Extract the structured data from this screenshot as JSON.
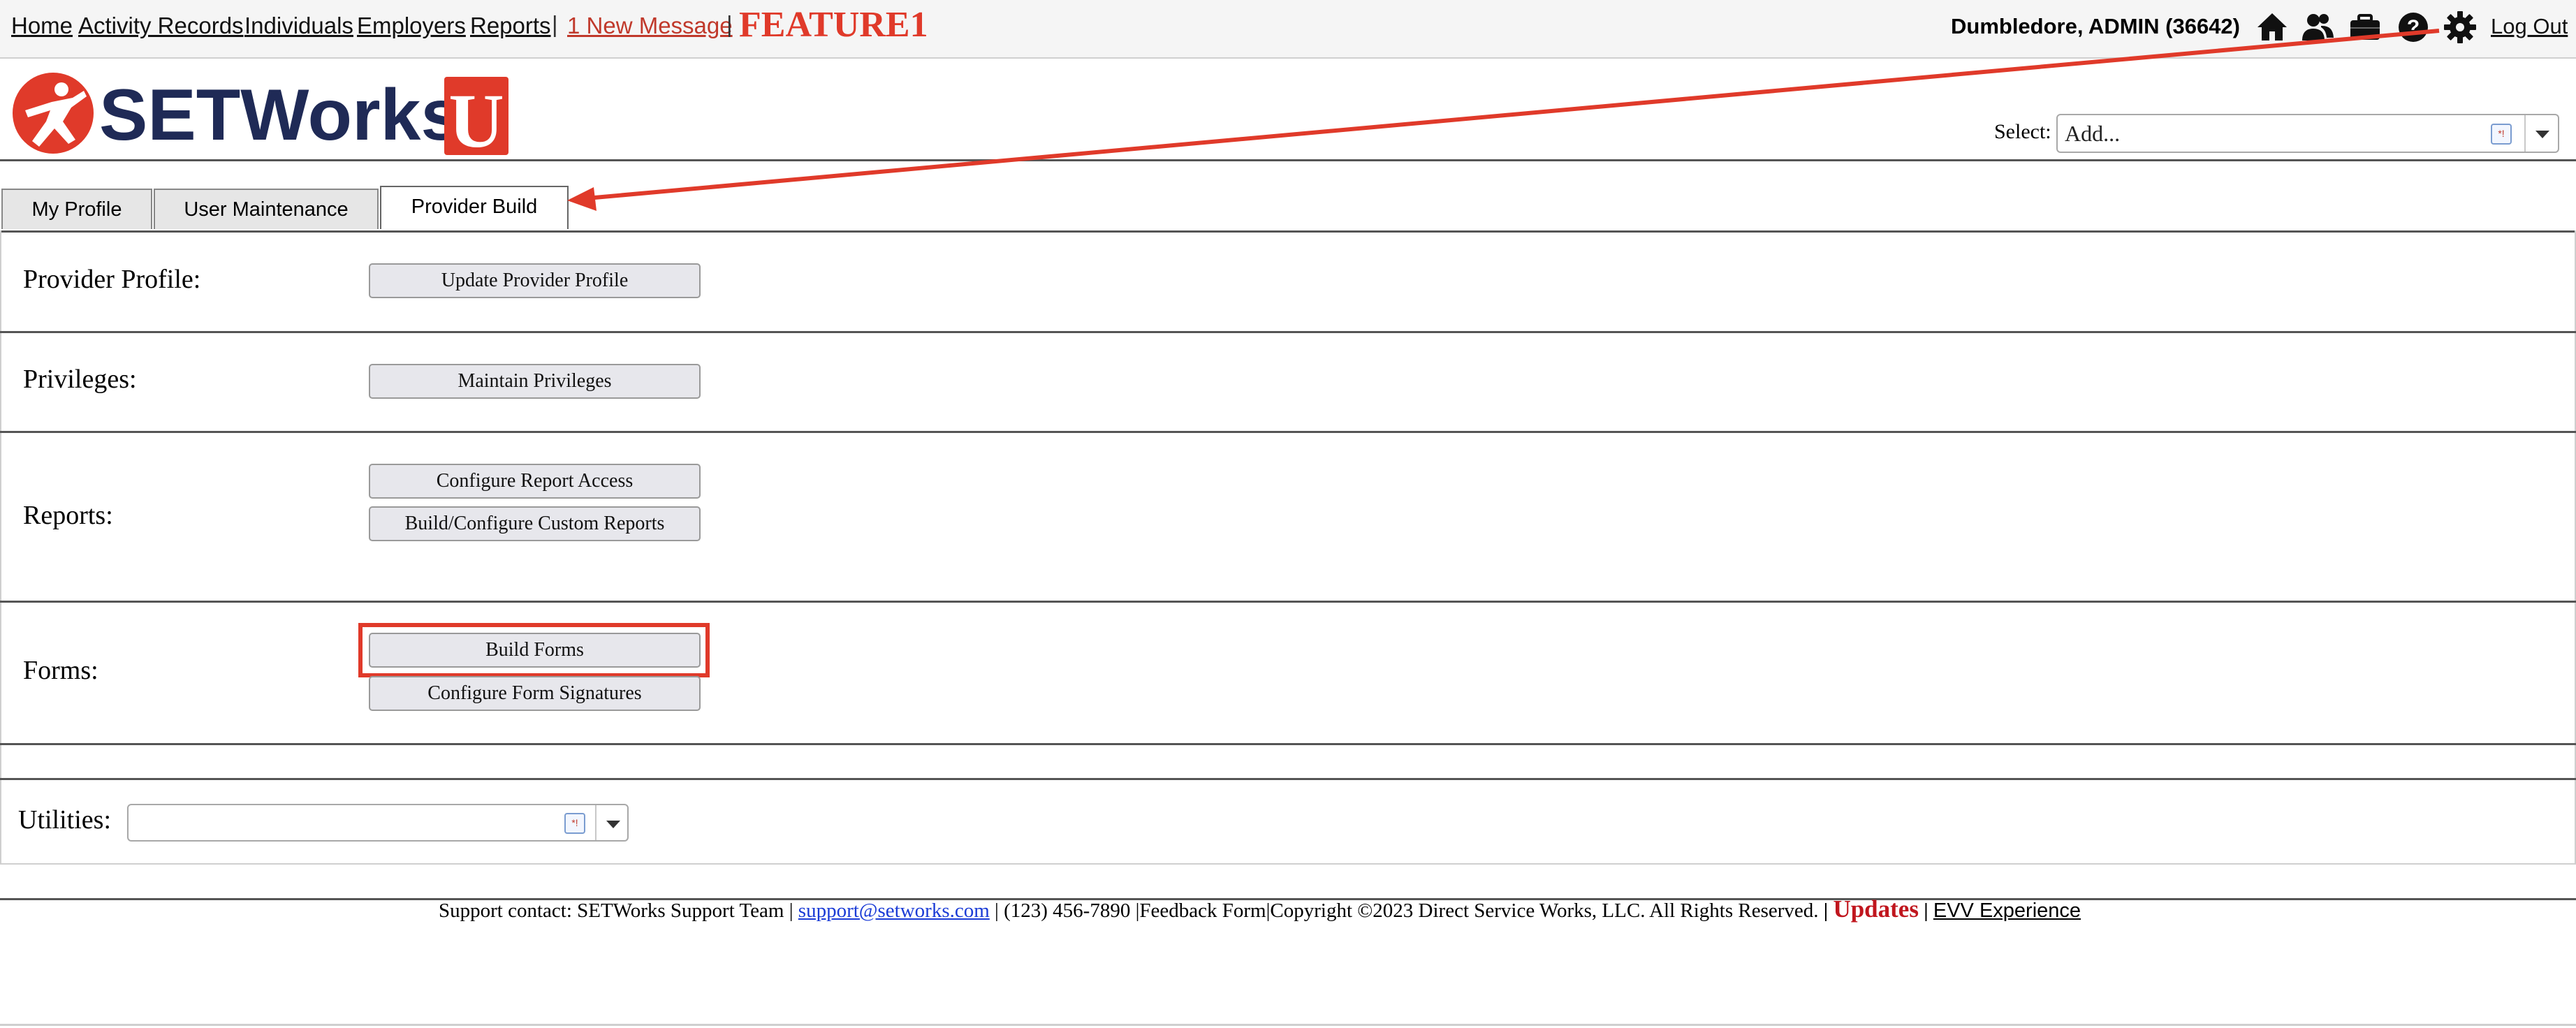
{
  "nav": {
    "links": [
      "Home",
      "Activity Records",
      "Individuals",
      "Employers",
      "Reports"
    ],
    "separator": "|",
    "message": "1 New Message",
    "feature": "FEATURE1",
    "user": "Dumbledore, ADMIN  (36642)",
    "logout": "Log Out",
    "icons": [
      "home-icon",
      "people-icon",
      "briefcase-icon",
      "help-icon",
      "settings-gear-icon"
    ]
  },
  "header": {
    "logo_text": "SETWorks",
    "logo_u": "U",
    "select_label": "Select:",
    "select_value": "Add..."
  },
  "tabs": [
    {
      "label": "My Profile",
      "active": false
    },
    {
      "label": "User Maintenance",
      "active": false
    },
    {
      "label": "Provider Build",
      "active": true
    }
  ],
  "sections": {
    "provider_profile": {
      "label": "Provider Profile:",
      "buttons": [
        "Update Provider Profile"
      ]
    },
    "privileges": {
      "label": "Privileges:",
      "buttons": [
        "Maintain Privileges"
      ]
    },
    "reports": {
      "label": "Reports:",
      "buttons": [
        "Configure Report Access",
        "Build/Configure Custom Reports"
      ]
    },
    "forms": {
      "label": "Forms:",
      "buttons": [
        "Build Forms",
        "Configure Form Signatures"
      ]
    },
    "utilities": {
      "label": "Utilities:",
      "value": ""
    }
  },
  "footer": {
    "support": "Support contact: SETWorks Support Team | ",
    "email": "support@setworks.com",
    "rest": " | (123) 456-7890 |Feedback Form|Copyright ©2023 Direct Service Works, LLC. All Rights Reserved. ",
    "sep": "|",
    "updates": "Updates",
    "evv": "EVV Experience"
  },
  "colors": {
    "accent_red": "#e03a2a",
    "logo_navy": "#1f2a56",
    "link_blue": "#1a3bd6"
  }
}
